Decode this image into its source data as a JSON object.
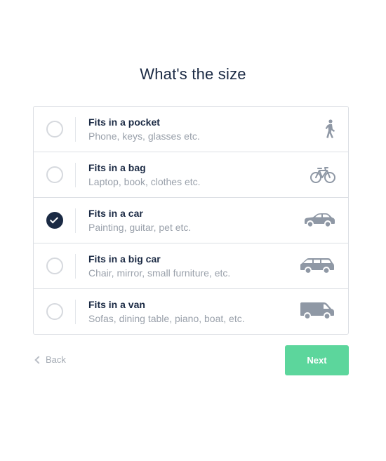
{
  "title": "What's the size",
  "options": [
    {
      "title": "Fits in a pocket",
      "subtitle": "Phone, keys, glasses etc.",
      "icon": "walking-person-icon",
      "selected": false
    },
    {
      "title": "Fits in a bag",
      "subtitle": "Laptop, book, clothes etc.",
      "icon": "bicycle-icon",
      "selected": false
    },
    {
      "title": "Fits in a car",
      "subtitle": "Painting, guitar, pet etc.",
      "icon": "car-icon",
      "selected": true
    },
    {
      "title": "Fits in a big car",
      "subtitle": "Chair, mirror, small furniture, etc.",
      "icon": "suv-icon",
      "selected": false
    },
    {
      "title": "Fits in a van",
      "subtitle": "Sofas, dining table, piano, boat, etc.",
      "icon": "van-icon",
      "selected": false
    }
  ],
  "nav": {
    "back_label": "Back",
    "next_label": "Next"
  },
  "colors": {
    "primary_text": "#1b2a44",
    "secondary_text": "#9aa1ab",
    "border": "#dcdfe4",
    "next_button": "#5cd69c",
    "icon": "#8f98a5"
  }
}
